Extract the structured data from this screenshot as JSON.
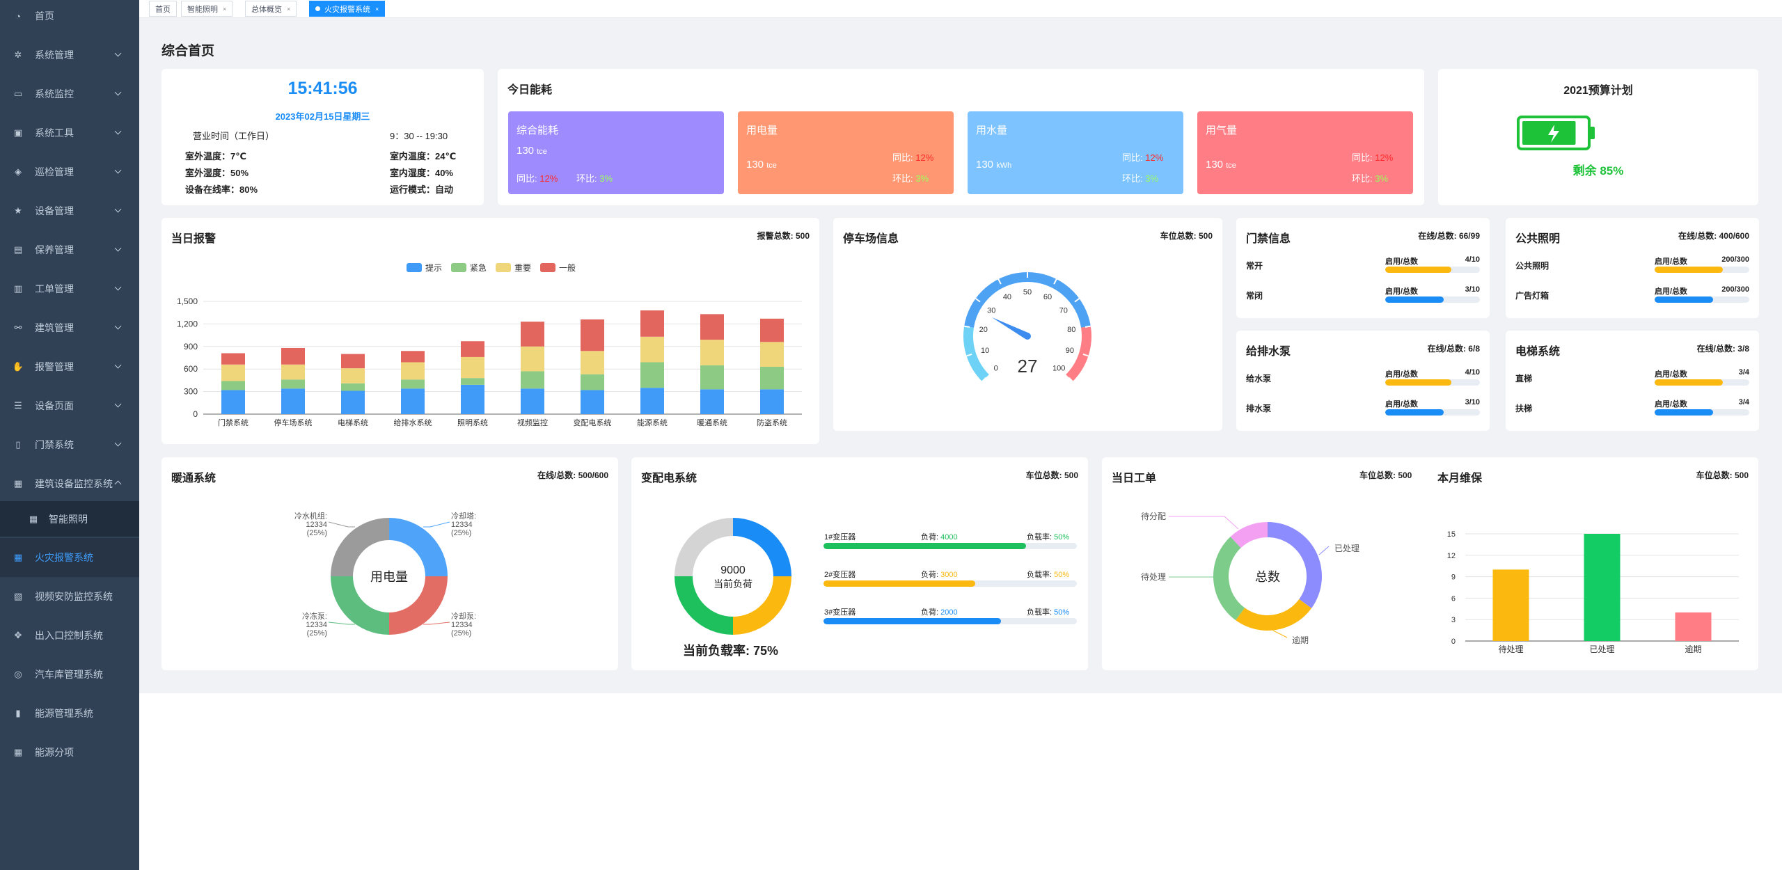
{
  "sidebar": {
    "items": [
      {
        "label": "首页",
        "icon": "dashboard-icon",
        "chev": ""
      },
      {
        "label": "系统管理",
        "icon": "gear-icon",
        "chev": "down"
      },
      {
        "label": "系统监控",
        "icon": "monitor-icon",
        "chev": "down"
      },
      {
        "label": "系统工具",
        "icon": "toolbox-icon",
        "chev": "down"
      },
      {
        "label": "巡检管理",
        "icon": "layers-icon",
        "chev": "down"
      },
      {
        "label": "设备管理",
        "icon": "star-icon",
        "chev": "down"
      },
      {
        "label": "保养管理",
        "icon": "clipboard-icon",
        "chev": "down"
      },
      {
        "label": "工单管理",
        "icon": "book-icon",
        "chev": "down"
      },
      {
        "label": "建筑管理",
        "icon": "hierarchy-icon",
        "chev": "down"
      },
      {
        "label": "报警管理",
        "icon": "hand-icon",
        "chev": "down"
      },
      {
        "label": "设备页面",
        "icon": "list-icon",
        "chev": "down"
      },
      {
        "label": "门禁系统",
        "icon": "door-icon",
        "chev": "down"
      },
      {
        "label": "建筑设备监控系统",
        "icon": "grid-icon",
        "chev": "up"
      },
      {
        "label": "智能照明",
        "icon": "grid-icon",
        "chev": "",
        "sub": true
      },
      {
        "label": "火灾报警系统",
        "icon": "grid-icon",
        "chev": "",
        "active": true
      },
      {
        "label": "视频安防监控系统",
        "icon": "video-icon",
        "chev": ""
      },
      {
        "label": "出入口控制系统",
        "icon": "move-icon",
        "chev": ""
      },
      {
        "label": "汽车库管理系统",
        "icon": "steering-icon",
        "chev": ""
      },
      {
        "label": "能源管理系统",
        "icon": "bar-chart-icon",
        "chev": ""
      },
      {
        "label": "能源分项",
        "icon": "grid-icon",
        "chev": ""
      }
    ]
  },
  "tabs": [
    {
      "label": "首页",
      "close": false
    },
    {
      "label": "智能照明",
      "close": true
    },
    {
      "label": "总体概览",
      "close": true
    },
    {
      "label": "火灾报警系统",
      "close": true,
      "active": true
    }
  ],
  "page_title": "综合首页",
  "clock": {
    "time": "15:41:56",
    "date": "2023年02月15日星期三",
    "hours_label": "营业时间（工作日）",
    "hours_value": "9：30 -- 19:30",
    "rows": [
      [
        "室外温度：7℃",
        "室内温度：24℃"
      ],
      [
        "室外湿度：50%",
        "室内湿度：40%"
      ],
      [
        "设备在线率：80%",
        "运行模式：自动"
      ]
    ]
  },
  "energy": {
    "title": "今日能耗",
    "boxes": [
      {
        "name": "综合能耗",
        "value": "130",
        "unit": "tce",
        "yoy_label": "同比:",
        "yoy": "12%",
        "mom_label": "环比:",
        "mom": "3%",
        "color": "#9e8cff"
      },
      {
        "name": "用电量",
        "value": "130",
        "unit": "tce",
        "yoy_label": "同比:",
        "yoy": "12%",
        "mom_label": "环比:",
        "mom": "3%",
        "color": "#ff9872"
      },
      {
        "name": "用水量",
        "value": "130",
        "unit": "kWh",
        "yoy_label": "同比:",
        "yoy": "12%",
        "mom_label": "环比:",
        "mom": "3%",
        "color": "#7cc3ff"
      },
      {
        "name": "用气量",
        "value": "130",
        "unit": "tce",
        "yoy_label": "同比:",
        "yoy": "12%",
        "mom_label": "环比:",
        "mom": "3%",
        "color": "#ff7d84"
      }
    ]
  },
  "budget": {
    "title": "2021预算计划",
    "remaining_label": "剩余",
    "remaining": "85%",
    "level": 0.85,
    "battery_color": "#1ec238"
  },
  "alarms": {
    "title": "当日报警",
    "total": "报警总数: 500"
  },
  "parking": {
    "title": "停车场信息",
    "total": "车位总数: 500"
  },
  "access": {
    "title": "门禁信息",
    "total": "在线/总数: 66/99",
    "rows": [
      {
        "name": "常开",
        "label": "启用/总数",
        "value": "4/10",
        "level": 0.7,
        "color": "#fbb80f"
      },
      {
        "name": "常闭",
        "label": "启用/总数",
        "value": "3/10",
        "level": 0.62,
        "color": "#1a8cf5"
      }
    ]
  },
  "lighting": {
    "title": "公共照明",
    "total": "在线/总数: 400/600",
    "rows": [
      {
        "name": "公共照明",
        "label": "启用/总数",
        "value": "200/300",
        "level": 0.72,
        "color": "#fbb80f"
      },
      {
        "name": "广告灯箱",
        "label": "启用/总数",
        "value": "200/300",
        "level": 0.62,
        "color": "#1a8cf5"
      }
    ]
  },
  "pumps": {
    "title": "给排水泵",
    "total": "在线/总数: 6/8",
    "rows": [
      {
        "name": "给水泵",
        "label": "启用/总数",
        "value": "4/10",
        "level": 0.7,
        "color": "#fbb80f"
      },
      {
        "name": "排水泵",
        "label": "启用/总数",
        "value": "3/10",
        "level": 0.62,
        "color": "#1a8cf5"
      }
    ]
  },
  "elevator": {
    "title": "电梯系统",
    "total": "在线/总数: 3/8",
    "rows": [
      {
        "name": "直梯",
        "label": "启用/总数",
        "value": "3/4",
        "level": 0.72,
        "color": "#fbb80f"
      },
      {
        "name": "扶梯",
        "label": "启用/总数",
        "value": "3/4",
        "level": 0.62,
        "color": "#1a8cf5"
      }
    ]
  },
  "hvac": {
    "title": "暖通系统",
    "total": "在线/总数: 500/600",
    "center": "用电量"
  },
  "power": {
    "title": "变配电系统",
    "total": "车位总数: 500",
    "center_value": "9000",
    "center_label": "当前负荷",
    "load_rate_label": "当前负载率:",
    "load_rate": "75%",
    "transformers": [
      {
        "name": "1#变压器",
        "load_label": "负荷:",
        "load": "4000",
        "rate_label": "负载率:",
        "rate": "50%",
        "color": "#1ec05e",
        "level": 0.8
      },
      {
        "name": "2#变压器",
        "load_label": "负荷:",
        "load": "3000",
        "rate_label": "负载率:",
        "rate": "50%",
        "color": "#fbb80f",
        "level": 0.6
      },
      {
        "name": "3#变压器",
        "load_label": "负荷:",
        "load": "2000",
        "rate_label": "负载率:",
        "rate": "50%",
        "color": "#1a8cf5",
        "level": 0.7
      }
    ]
  },
  "workorder": {
    "title": "当日工单",
    "total": "车位总数: 500",
    "center": "总数"
  },
  "maintenance": {
    "title": "本月维保",
    "total": "车位总数: 500"
  },
  "chart_data": [
    {
      "type": "bar",
      "stacked": true,
      "categories": [
        "门禁系统",
        "停车场系统",
        "电梯系统",
        "给排水系统",
        "照明系统",
        "视频监控",
        "变配电系统",
        "能源系统",
        "暖通系统",
        "防盗系统"
      ],
      "series": [
        {
          "name": "提示",
          "color": "#3f9bf7",
          "values": [
            320,
            340,
            310,
            340,
            390,
            340,
            320,
            350,
            330,
            330
          ]
        },
        {
          "name": "紧急",
          "color": "#8dcb85",
          "values": [
            120,
            120,
            100,
            120,
            90,
            230,
            210,
            340,
            320,
            300
          ]
        },
        {
          "name": "重要",
          "color": "#f0d67a",
          "values": [
            220,
            200,
            200,
            230,
            280,
            330,
            310,
            340,
            340,
            330
          ]
        },
        {
          "name": "一般",
          "color": "#e2655e",
          "values": [
            150,
            220,
            190,
            150,
            210,
            330,
            420,
            350,
            340,
            310
          ]
        }
      ],
      "ylim": [
        0,
        1500
      ],
      "yticks": [
        "0",
        "300",
        "600",
        "900",
        "1,200",
        "1,500"
      ],
      "legend": "top-center",
      "grid": true
    },
    {
      "type": "gauge",
      "value": 27,
      "min": 0,
      "max": 100,
      "ticks": [
        "0",
        "10",
        "20",
        "30",
        "40",
        "50",
        "60",
        "70",
        "80",
        "90",
        "100"
      ]
    },
    {
      "type": "pie",
      "donut": true,
      "slices": [
        {
          "name": "冷却塔",
          "value": 12334,
          "pct": "(25%)",
          "color": "#4fa4f9"
        },
        {
          "name": "冷却泵",
          "value": 12334,
          "pct": "(25%)",
          "color": "#e26d65"
        },
        {
          "name": "冷冻泵",
          "value": 12334,
          "pct": "(25%)",
          "color": "#5dbd7f"
        },
        {
          "name": "冷水机组",
          "value": 12334,
          "pct": "(25%)",
          "color": "#9b9b9b"
        }
      ]
    },
    {
      "type": "pie",
      "donut": true,
      "slices": [
        {
          "value": 25,
          "color": "#1a8cf5"
        },
        {
          "value": 25,
          "color": "#fbb80f"
        },
        {
          "value": 25,
          "color": "#1ec05e"
        },
        {
          "value": 25,
          "color": "#d4d4d4"
        }
      ]
    },
    {
      "type": "pie",
      "donut": true,
      "slices": [
        {
          "name": "已处理",
          "value": 35,
          "color": "#8d8cff"
        },
        {
          "name": "逾期",
          "value": 25,
          "color": "#fbb80f"
        },
        {
          "name": "待处理",
          "value": 28,
          "color": "#7dcc8a"
        },
        {
          "name": "待分配",
          "value": 12,
          "color": "#f3a0f3"
        }
      ]
    },
    {
      "type": "bar",
      "categories": [
        "待处理",
        "已处理",
        "逾期"
      ],
      "values": [
        10,
        15,
        4
      ],
      "colors": [
        "#fbb80f",
        "#14cc64",
        "#ff7d84"
      ],
      "ylim": [
        0,
        15
      ],
      "yticks": [
        "0",
        "3",
        "6",
        "9",
        "12",
        "15"
      ],
      "grid": true
    }
  ]
}
